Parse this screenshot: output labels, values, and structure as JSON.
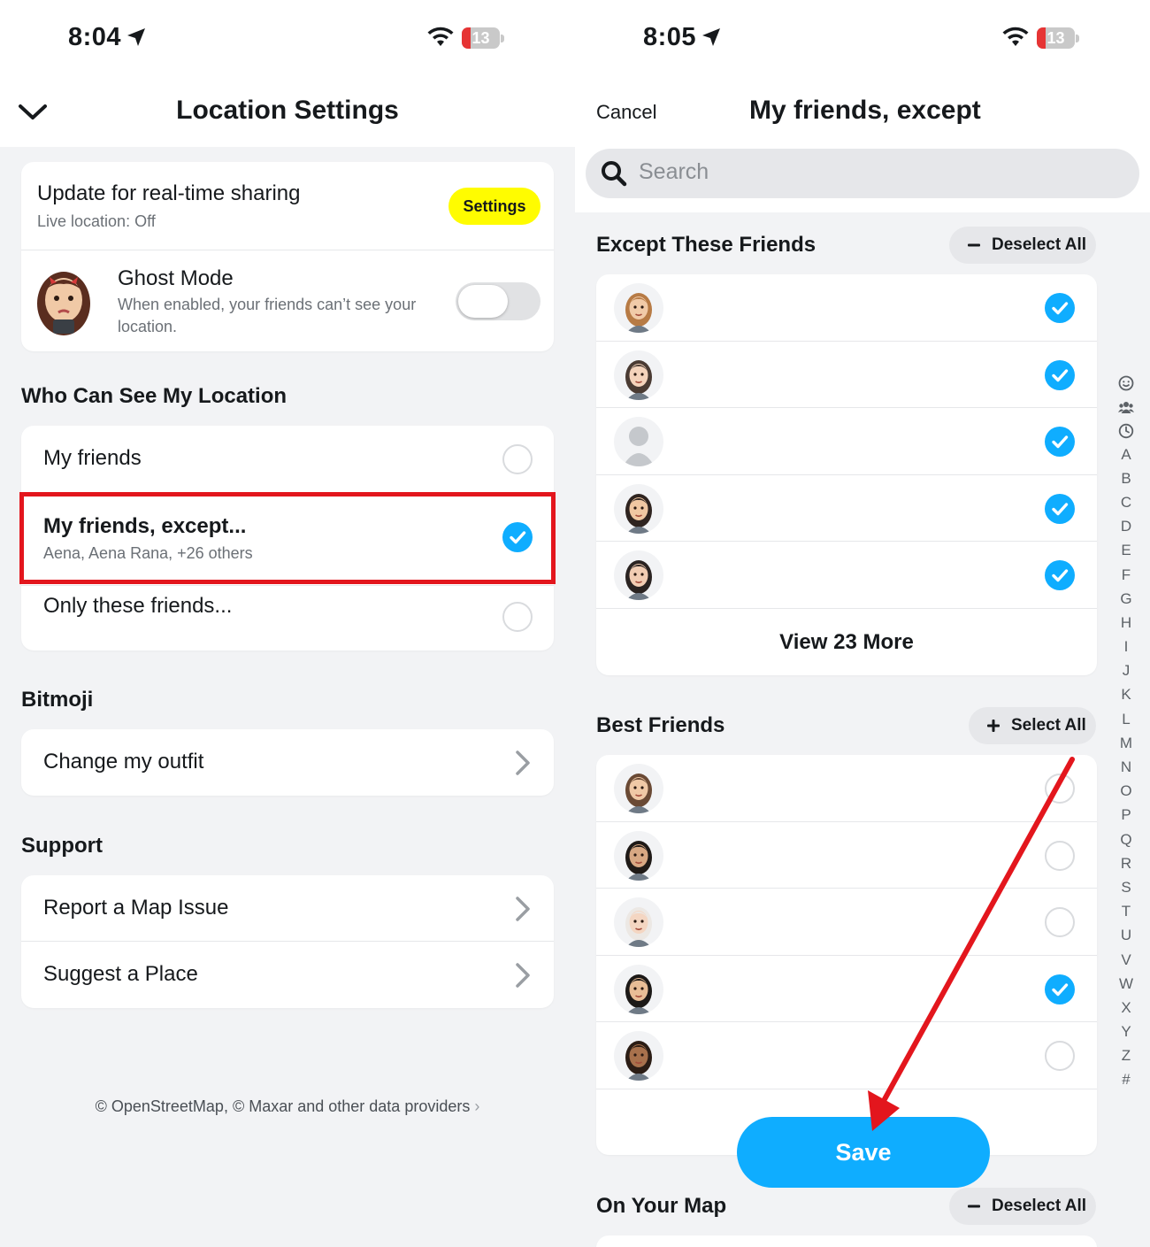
{
  "left": {
    "status": {
      "time": "8:04",
      "battery": "13"
    },
    "nav": {
      "title": "Location Settings"
    },
    "realtime": {
      "title": "Update for real-time sharing",
      "subtitle": "Live location: Off",
      "button": "Settings"
    },
    "ghost": {
      "title": "Ghost Mode",
      "line1": "When enabled, your friends can’t see your",
      "line2": "location.",
      "enabled": false
    },
    "who_section": "Who Can See My Location",
    "who_options": [
      {
        "label": "My friends",
        "selected": false
      },
      {
        "label": "My friends, except...",
        "sub": "Aena, Aena Rana, +26 others",
        "selected": true
      },
      {
        "label": "Only these friends...",
        "selected": false
      }
    ],
    "bitmoji_section": "Bitmoji",
    "bitmoji_item": "Change my outfit",
    "support_section": "Support",
    "support_items": [
      "Report a Map Issue",
      "Suggest a Place"
    ],
    "footer": "© OpenStreetMap, © Maxar and other data providers"
  },
  "right": {
    "status": {
      "time": "8:05",
      "battery": "13"
    },
    "nav": {
      "cancel": "Cancel",
      "title": "My friends, except"
    },
    "search": {
      "placeholder": "Search"
    },
    "except_section": {
      "title": "Except These Friends",
      "action": "Deselect All",
      "view_more": "View 23 More"
    },
    "except_checked": [
      true,
      true,
      true,
      true,
      true
    ],
    "best_section": {
      "title": "Best Friends",
      "action": "Select All"
    },
    "best_checked": [
      false,
      false,
      false,
      true,
      false
    ],
    "save": "Save",
    "map_section": {
      "title": "On Your Map",
      "action": "Deselect All"
    },
    "alphabet": [
      "A",
      "B",
      "C",
      "D",
      "E",
      "F",
      "G",
      "H",
      "I",
      "J",
      "K",
      "L",
      "M",
      "N",
      "O",
      "P",
      "Q",
      "R",
      "S",
      "T",
      "U",
      "V",
      "W",
      "X",
      "Y",
      "Z",
      "#"
    ]
  },
  "colors": {
    "accent_blue": "#0fadff",
    "settings_yellow": "#fffc00",
    "highlight_red": "#e3161d"
  }
}
